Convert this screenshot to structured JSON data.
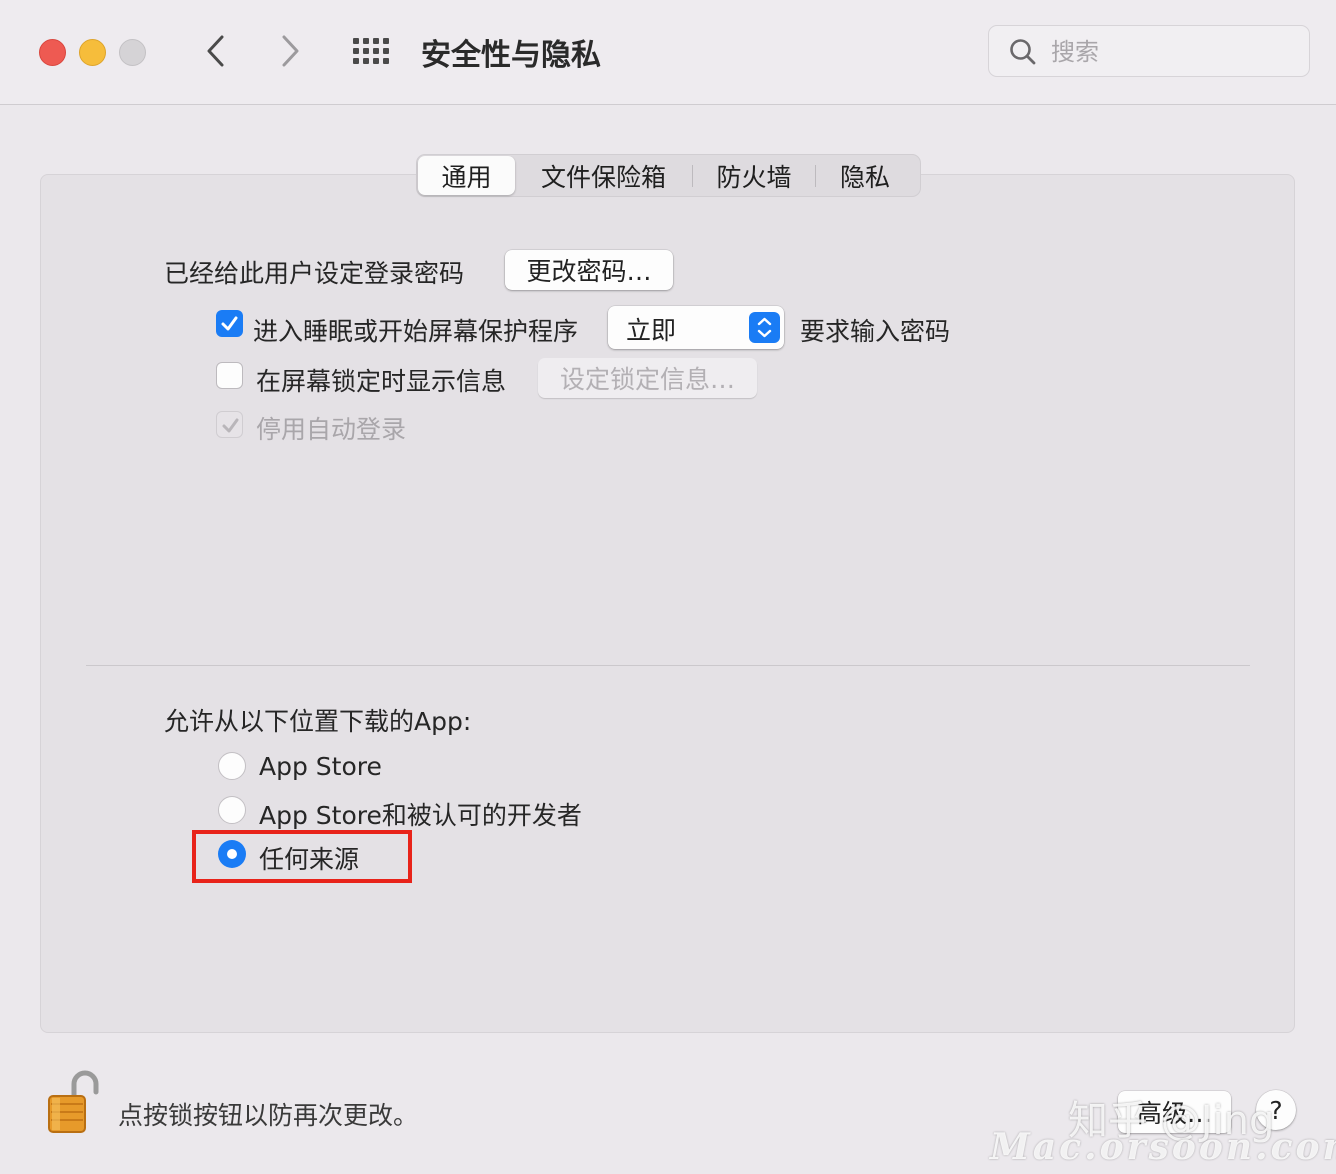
{
  "window": {
    "title": "安全性与隐私",
    "search_placeholder": "搜索"
  },
  "tabs": [
    {
      "label": "通用",
      "selected": true
    },
    {
      "label": "文件保险箱",
      "selected": false
    },
    {
      "label": "防火墙",
      "selected": false
    },
    {
      "label": "隐私",
      "selected": false
    }
  ],
  "general": {
    "password_set_label": "已经给此用户设定登录密码",
    "change_password_button": "更改密码…",
    "require_password": {
      "checked": true,
      "label": "进入睡眠或开始屏幕保护程序",
      "delay_value": "立即",
      "suffix": "要求输入密码"
    },
    "lock_message": {
      "checked": false,
      "label": "在屏幕锁定时显示信息",
      "button": "设定锁定信息…"
    },
    "disable_auto_login": {
      "checked": true,
      "disabled": true,
      "label": "停用自动登录"
    }
  },
  "downloads": {
    "heading": "允许从以下位置下载的App:",
    "options": [
      {
        "label": "App Store",
        "selected": false
      },
      {
        "label": "App Store和被认可的开发者",
        "selected": false
      },
      {
        "label": "任何来源",
        "selected": true
      }
    ]
  },
  "footer": {
    "lock_text": "点按锁按钮以防再次更改。",
    "advanced_button": "高级…",
    "help_button": "?"
  },
  "watermark": {
    "line1": "知乎 @Jing",
    "line2": "Mac.orsoon.com"
  },
  "colors": {
    "accent": "#1a7cf5",
    "highlight_box": "#e8231a",
    "close": "#ee5a52",
    "minimize": "#f6bd3b"
  }
}
